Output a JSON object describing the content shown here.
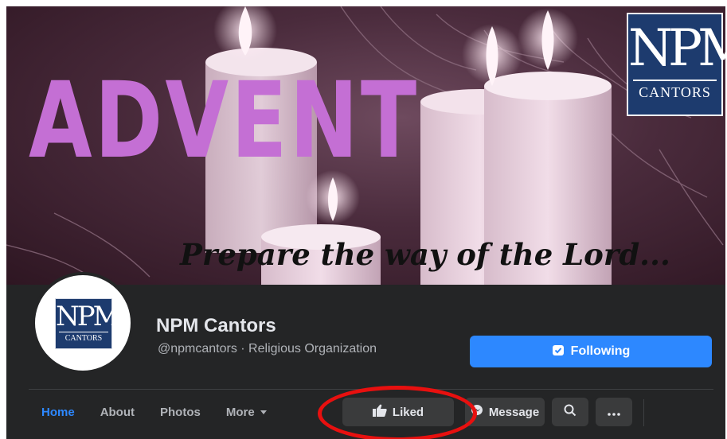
{
  "cover": {
    "headline": "ADVENT",
    "tagline": "Prepare the way of the Lord...",
    "logo": {
      "monogram": "NPM",
      "word": "CANTORS"
    }
  },
  "profile": {
    "avatar_logo": {
      "monogram": "NPM",
      "word": "CANTORS"
    },
    "name": "NPM Cantors",
    "subtitle": "@npmcantors · Religious Organization",
    "follow_button": "Following"
  },
  "tabs": [
    {
      "label": "Home",
      "active": true
    },
    {
      "label": "About",
      "active": false
    },
    {
      "label": "Photos",
      "active": false
    },
    {
      "label": "More",
      "active": false
    }
  ],
  "actions": {
    "liked": "Liked",
    "message": "Message",
    "search_icon": "search-icon",
    "more_icon": "more-horizontal-icon"
  },
  "colors": {
    "accent": "#2d88ff",
    "headline": "#c46fd4",
    "bar_background": "#242526",
    "annotation": "#e8100f"
  }
}
